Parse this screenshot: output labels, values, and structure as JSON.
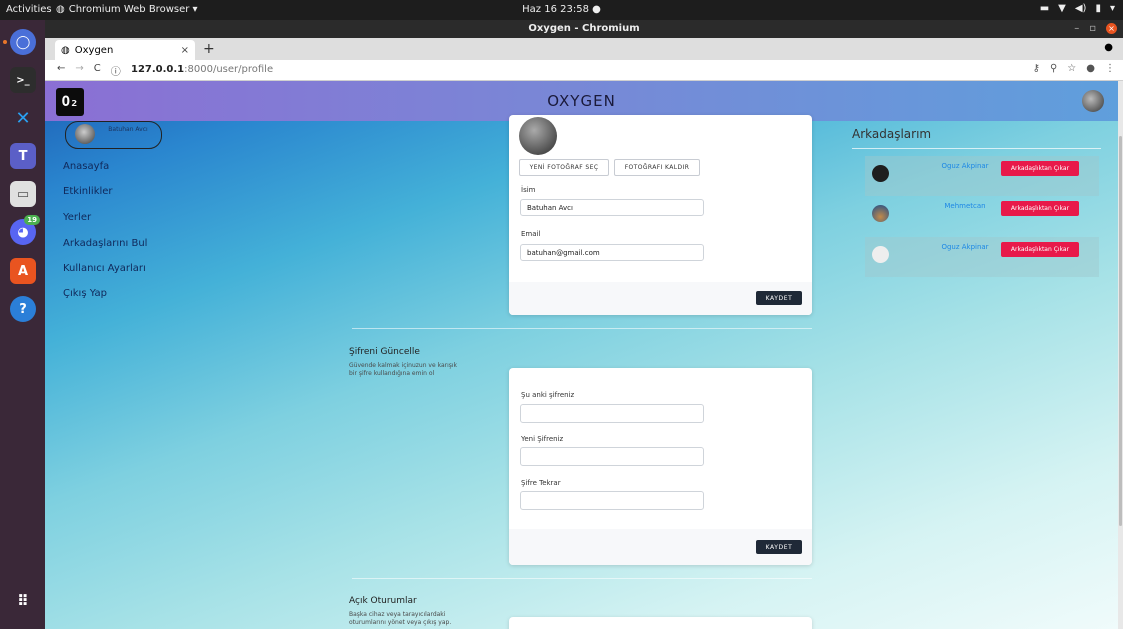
{
  "os": {
    "activities": "Activities",
    "app_menu": "Chromium Web Browser ▾",
    "clock": "Haz 16  23:58  ●",
    "dock_badge": "19"
  },
  "browser": {
    "window_title": "Oxygen - Chromium",
    "tab_title": "Oxygen",
    "tab_close": "×",
    "new_tab": "+",
    "url_host": "127.0.0.1",
    "url_path": ":8000/user/profile"
  },
  "site": {
    "logo": "O₂",
    "brand": "OXYGEN"
  },
  "sidebar": {
    "user_name": "Batuhan Avcı",
    "items": [
      {
        "label": "Anasayfa"
      },
      {
        "label": "Etkinlikler"
      },
      {
        "label": "Yerler"
      },
      {
        "label": "Arkadaşlarını Bul"
      },
      {
        "label": "Kullanıcı Ayarları"
      },
      {
        "label": "Çıkış Yap"
      }
    ]
  },
  "profile_card": {
    "select_photo": "YENİ FOTOĞRAF SEÇ",
    "remove_photo": "FOTOĞRAFI KALDIR",
    "name_label": "İsim",
    "name_value": "Batuhan Avcı",
    "email_label": "Email",
    "email_value": "batuhan@gmail.com",
    "save": "KAYDET"
  },
  "password_section": {
    "title": "Şifreni Güncelle",
    "description": "Güvende kalmak içinuzun ve karışık bir şifre kullandığına emin ol",
    "current_label": "Şu anki şifreniz",
    "new_label": "Yeni Şifreniz",
    "repeat_label": "Şifre Tekrar",
    "save": "KAYDET"
  },
  "sessions_section": {
    "title": "Açık Oturumlar",
    "description": "Başka cihaz veya tarayıcılardaki oturumlarını yönet veya çıkış yap."
  },
  "friends": {
    "title": "Arkadaşlarım",
    "items": [
      {
        "name": "Oguz Akpinar",
        "action": "Arkadaşlıktan Çıkar"
      },
      {
        "name": "Mehmetcan",
        "action": "Arkadaşlıktan Çıkar"
      },
      {
        "name": "Oguz Akpinar",
        "action": "Arkadaşlıktan Çıkar"
      }
    ]
  }
}
